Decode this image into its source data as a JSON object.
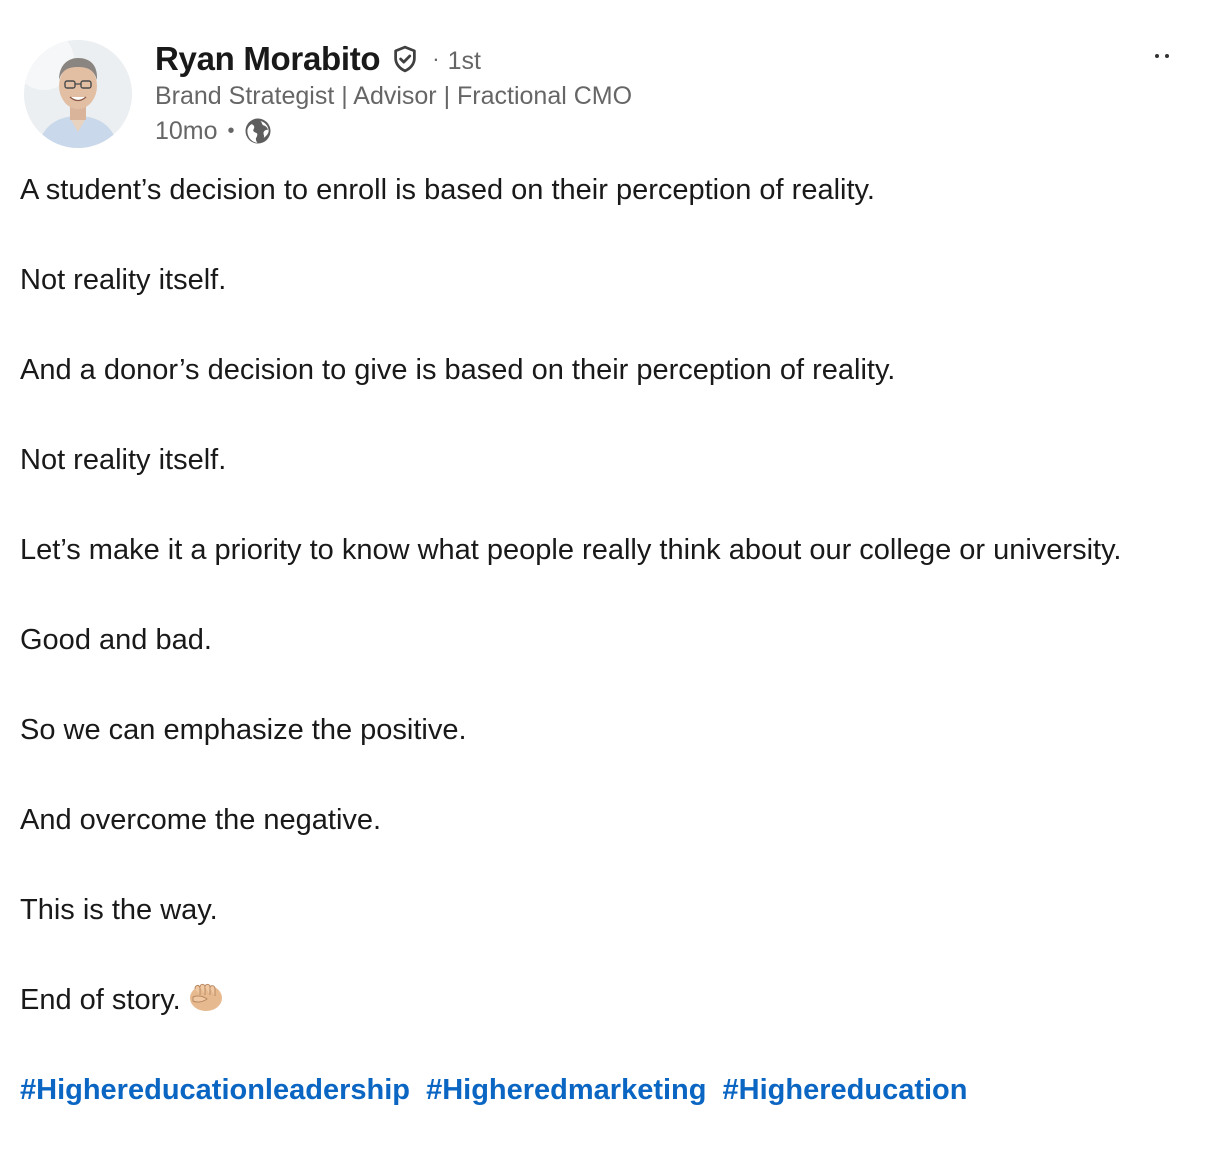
{
  "author": {
    "name": "Ryan Morabito",
    "degree_separator": "·",
    "degree": "1st",
    "headline": "Brand Strategist | Advisor | Fractional CMO",
    "time": "10mo",
    "time_separator": "•",
    "verified_icon": "verified-shield-icon",
    "visibility_icon": "globe-icon"
  },
  "post": {
    "paragraphs": [
      "A student’s decision to enroll is based on their perception of reality.",
      "Not reality itself.",
      "And a donor’s decision to give is based on their perception of reality.",
      "Not reality itself.",
      "Let’s make it a priority to know what people really think about our college or university.",
      "Good and bad.",
      "So we can emphasize the positive.",
      "And overcome the negative.",
      "This is the way.",
      "End of story."
    ],
    "final_emoji_icon": "fist-bump-icon",
    "hashtags": [
      "#Highereducationleadership",
      "#Higheredmarketing",
      "#Highereducation"
    ]
  },
  "controls": {
    "more_icon": "more-options-icon"
  },
  "colors": {
    "link": "#0a66c2",
    "secondary_text": "#666666",
    "primary_text": "#191919"
  }
}
